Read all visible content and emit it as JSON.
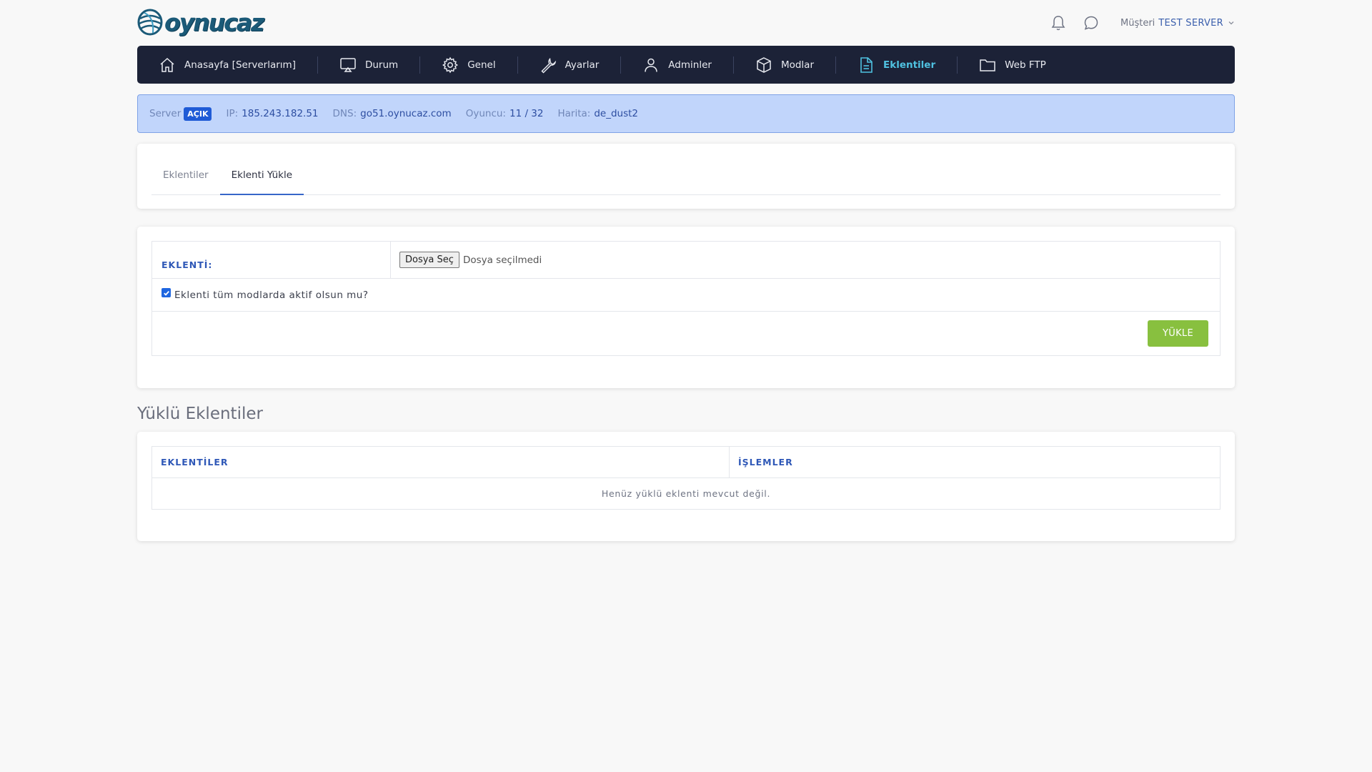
{
  "header": {
    "logo_text": "oynucaz",
    "user_prefix": "Müşteri",
    "user_name": "TEST SERVER"
  },
  "nav": {
    "items": [
      {
        "label": "Anasayfa [Serverlarım]",
        "icon": "home-icon"
      },
      {
        "label": "Durum",
        "icon": "monitor-icon"
      },
      {
        "label": "Genel",
        "icon": "gear-icon"
      },
      {
        "label": "Ayarlar",
        "icon": "wrench-icon"
      },
      {
        "label": "Adminler",
        "icon": "user-icon"
      },
      {
        "label": "Modlar",
        "icon": "box-icon"
      },
      {
        "label": "Eklentiler",
        "icon": "file-icon",
        "active": true
      },
      {
        "label": "Web FTP",
        "icon": "folder-icon"
      }
    ],
    "active_color": "#4fc1e0"
  },
  "server": {
    "server_label": "Server",
    "status": "AÇIK",
    "ip_label": "IP:",
    "ip": "185.243.182.51",
    "dns_label": "DNS:",
    "dns": "go51.oynucaz.com",
    "players_label": "Oyuncu:",
    "players": "11 / 32",
    "map_label": "Harita:",
    "map": "de_dust2"
  },
  "tabs": [
    {
      "label": "Eklentiler",
      "active": false
    },
    {
      "label": "Eklenti Yükle",
      "active": true
    }
  ],
  "upload_form": {
    "plugin_label": "EKLENTİ:",
    "file_button": "Dosya Seç",
    "file_status": "Dosya seçilmedi",
    "all_mods_label": "Eklenti tüm modlarda aktif olsun mu?",
    "all_mods_checked": true,
    "submit_label": "YÜKLE"
  },
  "installed": {
    "title": "Yüklü Eklentiler",
    "columns": [
      "EKLENTİLER",
      "İŞLEMLER"
    ],
    "empty_message": "Henüz yüklü eklenti mevcut değil."
  },
  "colors": {
    "nav_bg": "#1c2237",
    "info_bg": "#c1d5fb",
    "badge": "#1f5bd6",
    "button_green": "#88c03f"
  }
}
